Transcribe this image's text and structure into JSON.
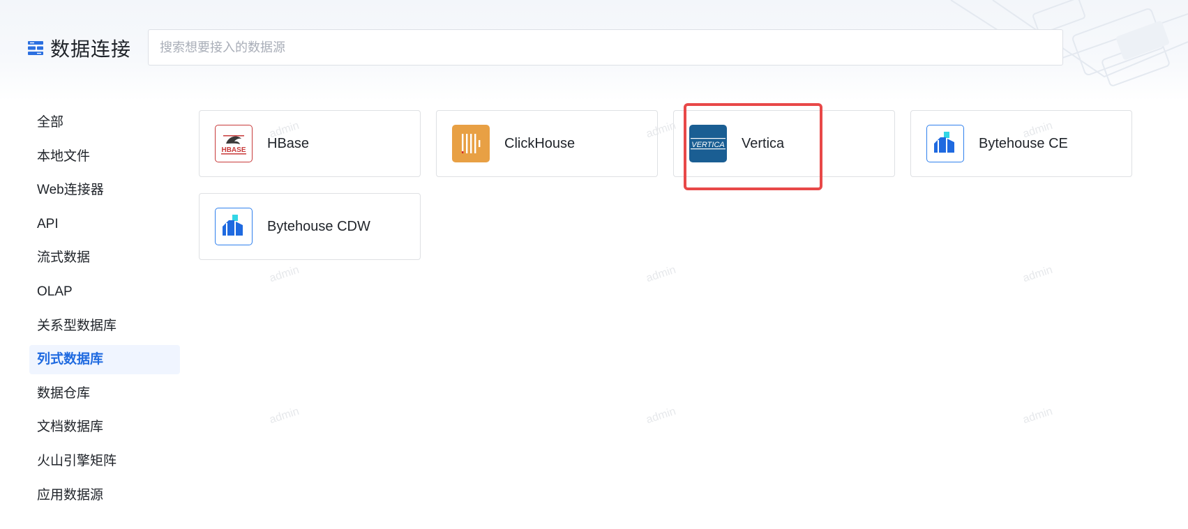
{
  "header": {
    "title": "数据连接",
    "search_placeholder": "搜索想要接入的数据源",
    "search_value": ""
  },
  "sidebar": {
    "items": [
      {
        "label": "全部"
      },
      {
        "label": "本地文件"
      },
      {
        "label": "Web连接器"
      },
      {
        "label": "API"
      },
      {
        "label": "流式数据"
      },
      {
        "label": "OLAP"
      },
      {
        "label": "关系型数据库"
      },
      {
        "label": "列式数据库",
        "active": true
      },
      {
        "label": "数据仓库"
      },
      {
        "label": "文档数据库"
      },
      {
        "label": "火山引擎矩阵"
      },
      {
        "label": "应用数据源"
      }
    ]
  },
  "sources": [
    {
      "label": "HBase",
      "icon": "hbase-logo-icon"
    },
    {
      "label": "ClickHouse",
      "icon": "clickhouse-logo-icon"
    },
    {
      "label": "Vertica",
      "icon": "vertica-logo-icon",
      "highlighted": true
    },
    {
      "label": "Bytehouse CE",
      "icon": "bytehouse-logo-icon"
    },
    {
      "label": "Bytehouse CDW",
      "icon": "bytehouse-logo-icon"
    }
  ],
  "logos": {
    "vertica_text": "VERTICA",
    "hbase_text": "HBASE"
  },
  "watermark": "admin",
  "colors": {
    "accent": "#1f6ae0",
    "active_bg": "#f0f5ff",
    "highlight": "#e84848",
    "clickhouse": "#e8a044",
    "vertica": "#1a5e93",
    "bytehouse": "#2f80ed"
  }
}
